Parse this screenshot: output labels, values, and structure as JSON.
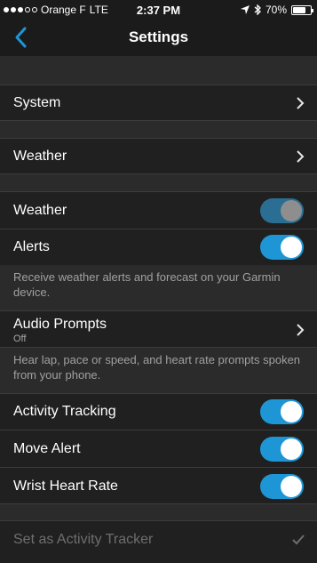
{
  "status_bar": {
    "carrier": "Orange F",
    "network": "LTE",
    "time": "2:37 PM",
    "battery_percent": "70%",
    "battery_level": 0.7,
    "signal_bars_filled": 3,
    "icons": [
      "location-arrow-icon",
      "bluetooth-icon",
      "battery-icon"
    ]
  },
  "nav": {
    "title": "Settings",
    "back_icon": "chevron-left-icon",
    "accent": "#1e96d6"
  },
  "rows": {
    "system": {
      "label": "System"
    },
    "weather_nav": {
      "label": "Weather"
    },
    "weather_toggle": {
      "label": "Weather",
      "on": true
    },
    "alerts": {
      "label": "Alerts",
      "on": true
    },
    "alerts_note": "Receive weather alerts and forecast on your Garmin device.",
    "audio_prompts": {
      "label": "Audio Prompts",
      "value": "Off"
    },
    "audio_note": "Hear lap, pace or speed, and heart rate prompts spoken from your phone.",
    "activity_tracking": {
      "label": "Activity Tracking",
      "on": true
    },
    "move_alert": {
      "label": "Move Alert",
      "on": true
    },
    "wrist_heart_rate": {
      "label": "Wrist Heart Rate",
      "on": true
    },
    "set_as_tracker": {
      "label": "Set as Activity Tracker",
      "checked": true
    }
  }
}
